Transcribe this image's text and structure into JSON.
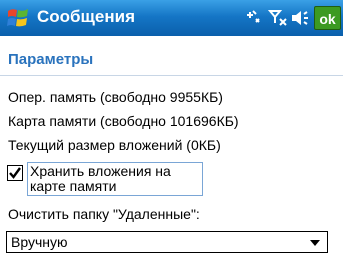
{
  "titlebar": {
    "app_title": "Сообщения",
    "status_icons": [
      "connectivity-icon",
      "signal-off-icon",
      "volume-icon"
    ],
    "ok_label": "ok"
  },
  "page": {
    "heading": "Параметры",
    "memory_ram": "Опер. память (свободно 9955КБ)",
    "memory_card": "Карта памяти (свободно 101696КБ)",
    "attachments_size": "Текущий размер вложений (0КБ)",
    "store_on_card": {
      "label": "Хранить вложения на карте памяти",
      "checked": true
    },
    "clear_deleted_label": "Очистить папку \"Удаленные\":",
    "clear_deleted_value": "Вручную"
  },
  "colors": {
    "titlebar": "#1576c6",
    "heading": "#2a73bd",
    "ok_button": "#3c9a22"
  }
}
